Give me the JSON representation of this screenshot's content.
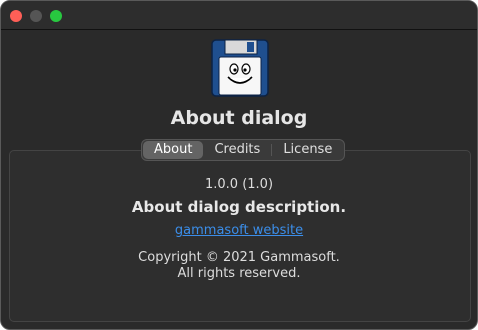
{
  "window": {
    "traffic_lights": [
      "close",
      "minimize",
      "zoom"
    ]
  },
  "app": {
    "icon": "floppy-disk-face-icon",
    "title": "About dialog"
  },
  "tabs": [
    {
      "label": "About",
      "active": true
    },
    {
      "label": "Credits",
      "active": false
    },
    {
      "label": "License",
      "active": false
    }
  ],
  "about": {
    "version": "1.0.0 (1.0)",
    "description": "About dialog description.",
    "website_label": "gammasoft website",
    "copyright_line1": "Copyright © 2021 Gammasoft.",
    "copyright_line2": "All rights reserved."
  },
  "colors": {
    "window_bg": "#2a2a2a",
    "link": "#3b8eea",
    "close": "#ff5f57",
    "zoom": "#28c840",
    "icon_blue": "#1f4f8f"
  }
}
